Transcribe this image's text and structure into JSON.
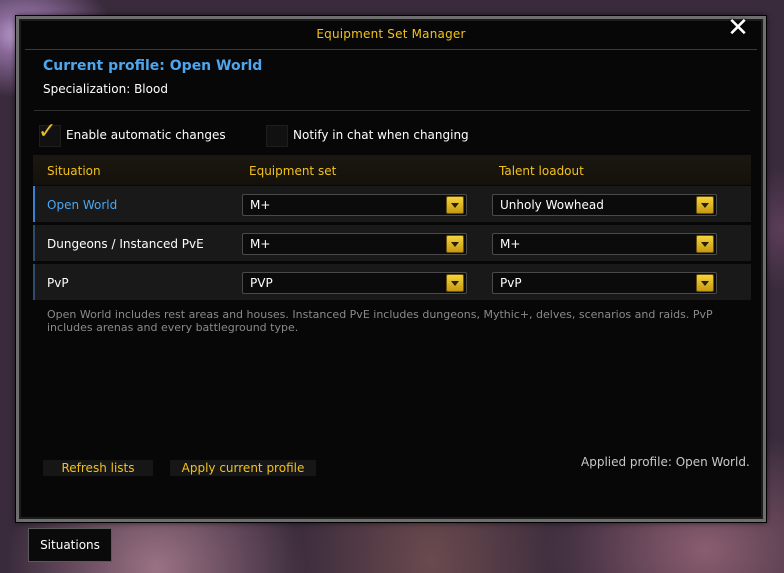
{
  "window": {
    "title": "Equipment Set Manager",
    "close_icon": "close-icon"
  },
  "profile": {
    "current": "Current profile: Open World",
    "specialization": "Specialization: Blood"
  },
  "options": {
    "auto_changes": {
      "label": "Enable automatic changes",
      "checked": true
    },
    "notify_chat": {
      "label": "Notify in chat when changing",
      "checked": false
    }
  },
  "table": {
    "headers": {
      "situation": "Situation",
      "equipment": "Equipment set",
      "talent": "Talent loadout"
    },
    "rows": [
      {
        "situation": "Open World",
        "equipment": "M+",
        "talent": "Unholy Wowhead",
        "active": true
      },
      {
        "situation": "Dungeons / Instanced PvE",
        "equipment": "M+",
        "talent": "M+",
        "active": false
      },
      {
        "situation": "PvP",
        "equipment": "PVP",
        "talent": "PvP",
        "active": false
      }
    ]
  },
  "help_text": "Open World includes rest areas and houses. Instanced PvE includes dungeons, Mythic+, delves, scenarios and raids. PvP includes arenas and every battleground type.",
  "buttons": {
    "refresh": "Refresh lists",
    "apply": "Apply current profile"
  },
  "status": "Applied profile: Open World.",
  "bottom_tab": "Situations",
  "colors": {
    "accent_gold": "#f3c21a",
    "accent_blue": "#4da6ee",
    "panel_bg": "#070707"
  }
}
